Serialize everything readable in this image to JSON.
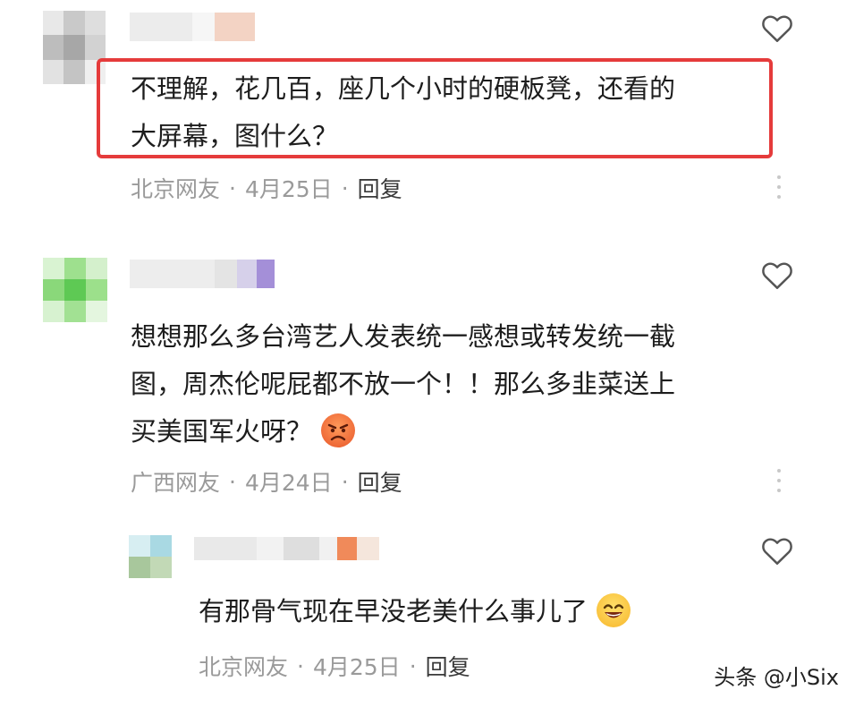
{
  "comments": [
    {
      "text_lines": [
        "不理解，花几百，座几个小时的硬板凳，还看的",
        "大屏幕，图什么？"
      ],
      "location": "北京网友",
      "date": "4月25日",
      "reply_label": "回复",
      "highlighted": true
    },
    {
      "text_lines": [
        "想想那么多台湾艺人发表统一感想或转发统一截",
        "图，周杰伦呢屁都不放一个！！那么多韭菜送上",
        "买美国军火呀？"
      ],
      "location": "广西网友",
      "date": "4月24日",
      "reply_label": "回复",
      "trailing_emoji": "angry-face-emoji"
    },
    {
      "text_lines": [
        "有那骨气现在早没老美什么事儿了"
      ],
      "location": "北京网友",
      "date": "4月25日",
      "reply_label": "回复",
      "trailing_emoji": "grinning-face-emoji",
      "is_reply": true
    }
  ],
  "separator": "·",
  "watermark": "头条 @小Six",
  "colors": {
    "highlight_border": "#e53b3b",
    "meta_text": "#9a9a9a",
    "body_text": "#1d1d1d"
  }
}
